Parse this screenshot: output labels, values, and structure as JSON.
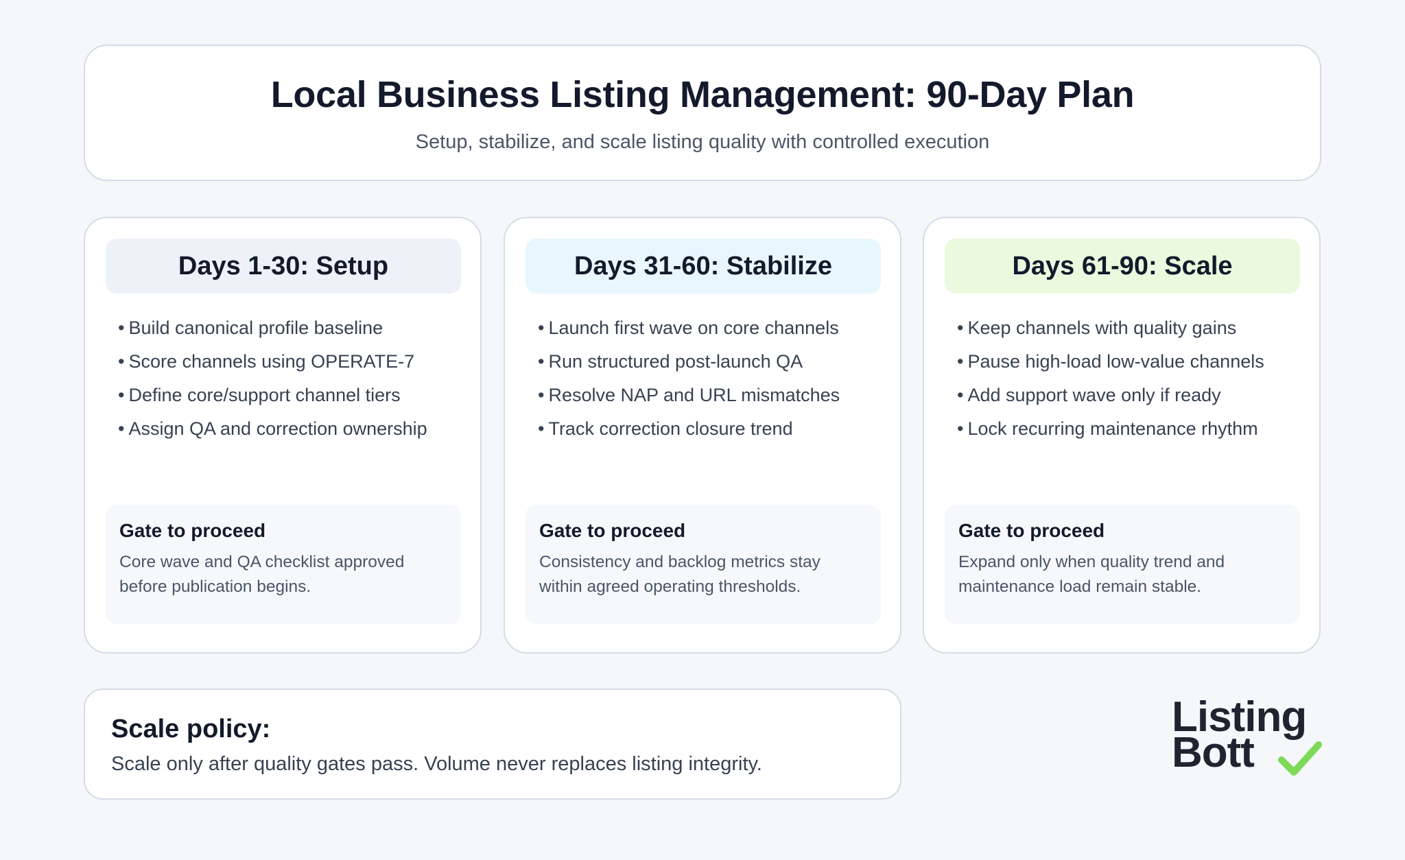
{
  "header": {
    "title": "Local Business Listing Management: 90-Day Plan",
    "subtitle": "Setup, stabilize, and scale listing quality with controlled execution"
  },
  "phases": [
    {
      "title": "Days 1-30: Setup",
      "items": [
        "Build canonical profile baseline",
        "Score channels using OPERATE-7",
        "Define core/support channel tiers",
        "Assign QA and correction ownership"
      ],
      "gate_title": "Gate to proceed",
      "gate_text_1": "Core wave and QA checklist approved",
      "gate_text_2": "before publication begins."
    },
    {
      "title": "Days 31-60: Stabilize",
      "items": [
        "Launch first wave on core channels",
        "Run structured post-launch QA",
        "Resolve NAP and URL mismatches",
        "Track correction closure trend"
      ],
      "gate_title": "Gate to proceed",
      "gate_text_1": "Consistency and backlog metrics stay",
      "gate_text_2": "within agreed operating thresholds."
    },
    {
      "title": "Days 61-90: Scale",
      "items": [
        "Keep channels with quality gains",
        "Pause high-load low-value channels",
        "Add support wave only if ready",
        "Lock recurring maintenance rhythm"
      ],
      "gate_title": "Gate to proceed",
      "gate_text_1": "Expand only when quality trend and",
      "gate_text_2": "maintenance load remain stable."
    }
  ],
  "bullet": "•",
  "policy": {
    "title": "Scale policy:",
    "text": "Scale only after quality gates pass. Volume never replaces listing integrity."
  },
  "logo": {
    "line1": "Listing",
    "line2": "Bott",
    "check_icon": "check-icon",
    "check_color": "#7ed957"
  },
  "colors": {
    "setup_header_bg": "#eef1f8",
    "stabilize_header_bg": "#e8f6fd",
    "scale_header_bg": "#ebf9df"
  }
}
